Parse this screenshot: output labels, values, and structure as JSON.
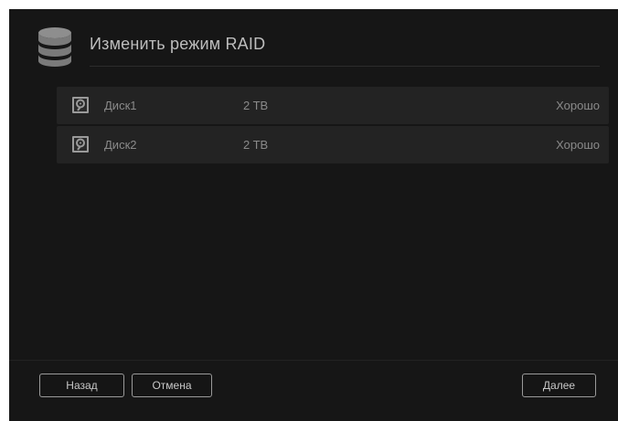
{
  "dialog": {
    "title": "Изменить режим RAID",
    "header_icon": "database-icon"
  },
  "disks": [
    {
      "icon": "hard-drive-icon",
      "name": "Диск1",
      "size": "2 TB",
      "status": "Хорошо"
    },
    {
      "icon": "hard-drive-icon",
      "name": "Диск2",
      "size": "2 TB",
      "status": "Хорошо"
    }
  ],
  "footer": {
    "back_label": "Назад",
    "cancel_label": "Отмена",
    "next_label": "Далее"
  },
  "colors": {
    "background": "#161616",
    "row": "#232323",
    "text": "#8a8a8a"
  }
}
